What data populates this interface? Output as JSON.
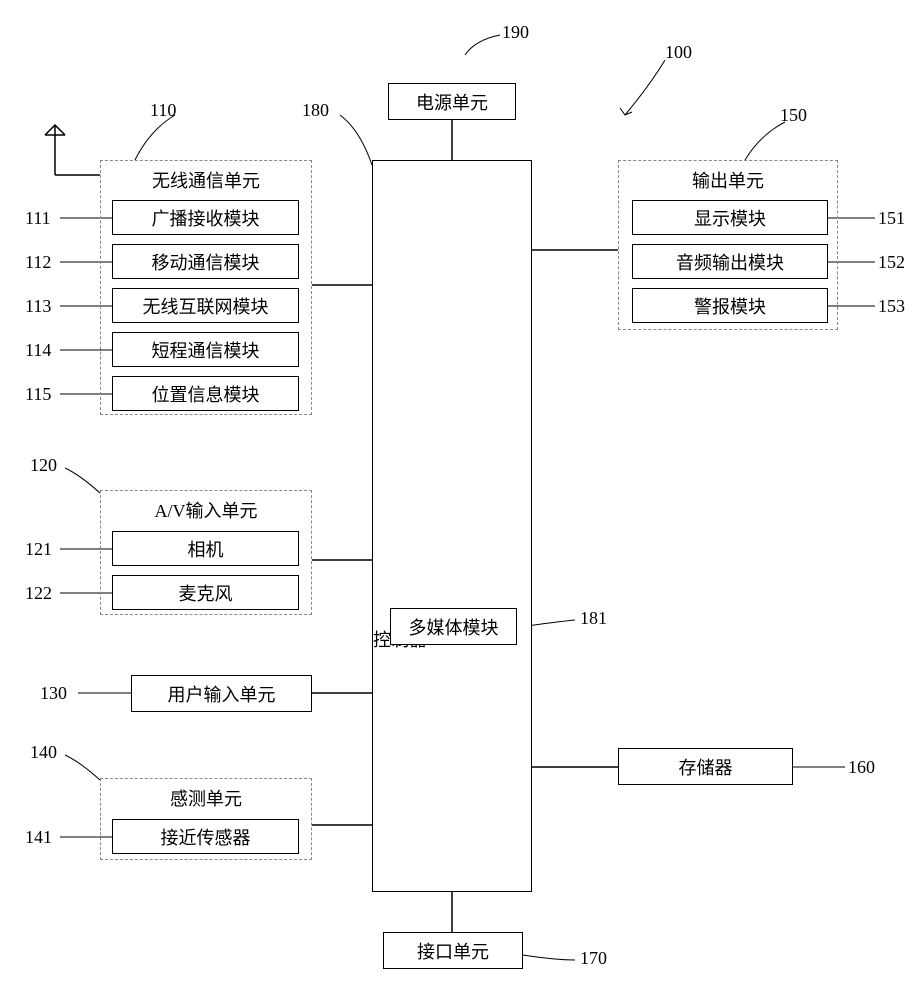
{
  "refs": {
    "r100": "100",
    "r110": "110",
    "r111": "111",
    "r112": "112",
    "r113": "113",
    "r114": "114",
    "r115": "115",
    "r120": "120",
    "r121": "121",
    "r122": "122",
    "r130": "130",
    "r140": "140",
    "r141": "141",
    "r150": "150",
    "r151": "151",
    "r152": "152",
    "r153": "153",
    "r160": "160",
    "r170": "170",
    "r180": "180",
    "r181": "181",
    "r190": "190"
  },
  "blocks": {
    "power": "电源单元",
    "wireless_unit": "无线通信单元",
    "broadcast_rx": "广播接收模块",
    "mobile_comm": "移动通信模块",
    "wireless_net": "无线互联网模块",
    "short_range": "短程通信模块",
    "position": "位置信息模块",
    "av_input": "A/V输入单元",
    "camera": "相机",
    "microphone": "麦克风",
    "user_input": "用户输入单元",
    "sensing_unit": "感测单元",
    "proximity": "接近传感器",
    "controller": "控制器",
    "multimedia": "多媒体模块",
    "output_unit": "输出单元",
    "display": "显示模块",
    "audio_out": "音频输出模块",
    "alarm": "警报模块",
    "memory": "存储器",
    "interface": "接口单元"
  }
}
